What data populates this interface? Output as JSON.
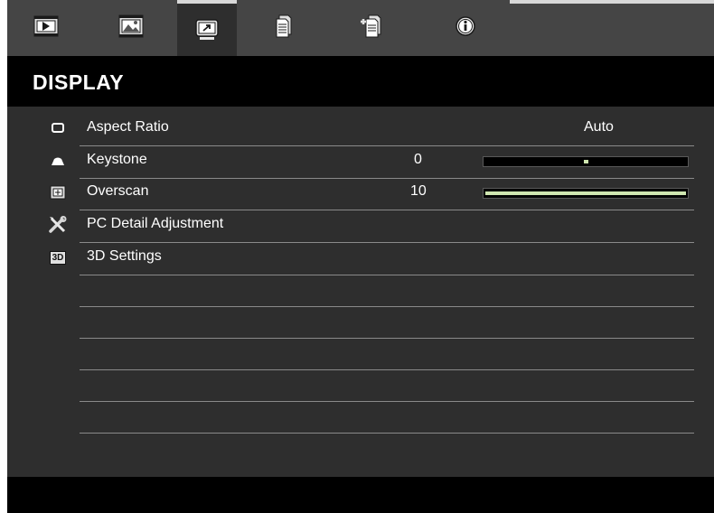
{
  "menu": {
    "title": "DISPLAY",
    "tabs": [
      {
        "icon": "play-icon",
        "active": false
      },
      {
        "icon": "image-icon",
        "active": false
      },
      {
        "icon": "display-icon",
        "active": true
      },
      {
        "icon": "document-icon",
        "active": false
      },
      {
        "icon": "document-plus-icon",
        "active": false
      },
      {
        "icon": "info-icon",
        "active": false
      }
    ],
    "items": [
      {
        "label": "Aspect Ratio",
        "icon": "aspect-ratio-icon",
        "value": "Auto"
      },
      {
        "label": "Keystone",
        "icon": "keystone-icon",
        "value": "0",
        "slider_fraction": 0.5
      },
      {
        "label": "Overscan",
        "icon": "overscan-icon",
        "value": "10",
        "slider_fraction": 1.0
      },
      {
        "label": "PC Detail Adjustment",
        "icon": "tools-icon"
      },
      {
        "label": "3D Settings",
        "icon": "3d-icon",
        "icon_text": "3D"
      }
    ]
  },
  "colors": {
    "background": "#2e2e2e",
    "tabbar": "#454545",
    "title_bar": "#000000",
    "slider_fill": "#cfe6b0",
    "divider": "#8a8a8a"
  }
}
